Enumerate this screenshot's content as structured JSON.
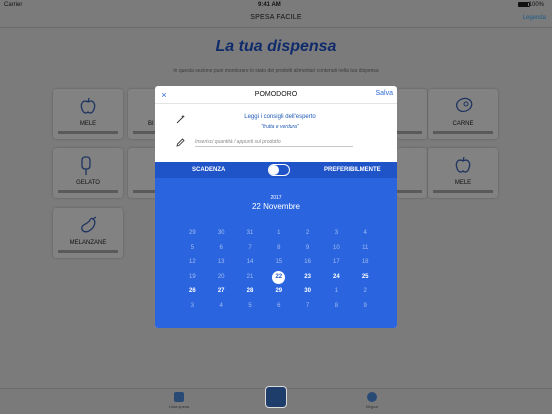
{
  "status": {
    "carrier": "Carrier",
    "time": "9:41 AM",
    "battery": "100%"
  },
  "nav": {
    "title": "SPESA FACILE",
    "legend": "Legenda"
  },
  "page": {
    "title": "La tua dispensa",
    "subtitle": "In questa sezione puoi monitorare lo stato dei prodotti alimentari contenuti nella tua dispensa"
  },
  "cards": [
    {
      "label": "MELE",
      "icon": "apple-icon"
    },
    {
      "label": "BI",
      "icon": "food-icon"
    },
    {
      "label": "CARNE",
      "icon": "meat-icon"
    },
    {
      "label": "GELATO",
      "icon": "ice-cream-icon"
    },
    {
      "label": "MELE",
      "icon": "apple-icon"
    },
    {
      "label": "MELANZANE",
      "icon": "eggplant-icon"
    }
  ],
  "modal": {
    "close": "×",
    "title": "POMODORO",
    "save": "Salva",
    "tips_title": "Leggi i consigli dell'esperto",
    "tips_sub": "\"frutta e verdura\"",
    "note_placeholder": "Inserisci quantità / appunti sul prodotto",
    "toggle_left": "SCADENZA",
    "toggle_right": "PREFERIBILMENTE"
  },
  "calendar": {
    "year": "2017",
    "date_title": "22 Novembre",
    "selected": "22",
    "rows": [
      [
        {
          "d": "29",
          "s": "dim"
        },
        {
          "d": "30",
          "s": "dim"
        },
        {
          "d": "31",
          "s": "dim"
        },
        {
          "d": "1",
          "s": "dim"
        },
        {
          "d": "2",
          "s": "dim"
        },
        {
          "d": "3",
          "s": "dim"
        },
        {
          "d": "4",
          "s": "dim"
        }
      ],
      [
        {
          "d": "5",
          "s": "dim"
        },
        {
          "d": "6",
          "s": "dim"
        },
        {
          "d": "7",
          "s": "dim"
        },
        {
          "d": "8",
          "s": "dim"
        },
        {
          "d": "9",
          "s": "dim"
        },
        {
          "d": "10",
          "s": "dim"
        },
        {
          "d": "11",
          "s": "dim"
        }
      ],
      [
        {
          "d": "12",
          "s": "dim"
        },
        {
          "d": "13",
          "s": "dim"
        },
        {
          "d": "14",
          "s": "dim"
        },
        {
          "d": "15",
          "s": "dim"
        },
        {
          "d": "16",
          "s": "dim"
        },
        {
          "d": "17",
          "s": "dim"
        },
        {
          "d": "18",
          "s": "dim"
        }
      ],
      [
        {
          "d": "19",
          "s": "dim"
        },
        {
          "d": "20",
          "s": "dim"
        },
        {
          "d": "21",
          "s": "dim"
        },
        {
          "d": "22",
          "s": "sel"
        },
        {
          "d": "23",
          "s": "bold"
        },
        {
          "d": "24",
          "s": "bold"
        },
        {
          "d": "25",
          "s": "bold"
        }
      ],
      [
        {
          "d": "26",
          "s": "bold"
        },
        {
          "d": "27",
          "s": "bold"
        },
        {
          "d": "28",
          "s": "bold"
        },
        {
          "d": "29",
          "s": "bold"
        },
        {
          "d": "30",
          "s": "bold"
        },
        {
          "d": "1",
          "s": "dim"
        },
        {
          "d": "2",
          "s": "dim"
        }
      ],
      [
        {
          "d": "3",
          "s": "dim"
        },
        {
          "d": "4",
          "s": "dim"
        },
        {
          "d": "5",
          "s": "dim"
        },
        {
          "d": "6",
          "s": "dim"
        },
        {
          "d": "7",
          "s": "dim"
        },
        {
          "d": "8",
          "s": "dim"
        },
        {
          "d": "9",
          "s": "dim"
        }
      ]
    ]
  },
  "tabs": [
    {
      "label": "Lista spesa",
      "icon": "list-icon"
    },
    {
      "label": "",
      "icon": "fridge-icon"
    },
    {
      "label": "Negozi",
      "icon": "location-icon"
    }
  ]
}
